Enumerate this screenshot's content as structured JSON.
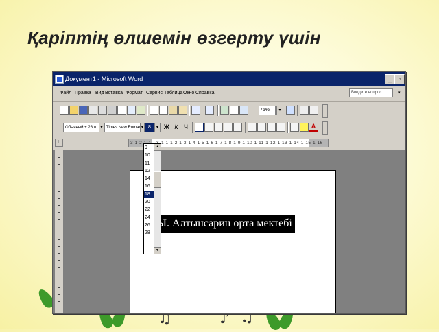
{
  "slide": {
    "title": "Қаріптің өлшемін өзгерту үшін"
  },
  "window": {
    "title": "Документ1 - Microsoft Word",
    "minimize": "_",
    "restore": "▫"
  },
  "menu": {
    "items": [
      "Файл",
      "Правка",
      "Вид",
      "Вставка",
      "Формат",
      "Сервис",
      "Таблица",
      "Окно",
      "Справка"
    ],
    "help_placeholder": "Введите вопрос"
  },
  "standard_toolbar": {
    "zoom": "75%"
  },
  "formatting_toolbar": {
    "style": "Обычный + 28 пт",
    "font": "Times New Roman",
    "size": "8",
    "bold": "Ж",
    "italic": "К",
    "underline": "Ч",
    "font_color_letter": "A"
  },
  "ruler": {
    "corner": "L",
    "numbers": "3·1·2·1·1· ·X·1·1·1·2·1·3·1·4·1·5·1·6·1·7·1·8·1·9·1·10·1·11·1·12·1·13·1·14·1·15·1·16"
  },
  "font_size_dropdown": {
    "options": [
      "9",
      "10",
      "11",
      "12",
      "14",
      "16",
      "18",
      "20",
      "22",
      "24",
      "26",
      "28"
    ],
    "selected_index": 6
  },
  "document": {
    "text": "Ы. Алтынсарин орта мектебі"
  },
  "colors": {
    "titlebar": "#0a246a",
    "chrome": "#d4d0c8",
    "workspace": "#808080",
    "highlight": "#0a246a",
    "slide_background": "#fdfbd8"
  }
}
